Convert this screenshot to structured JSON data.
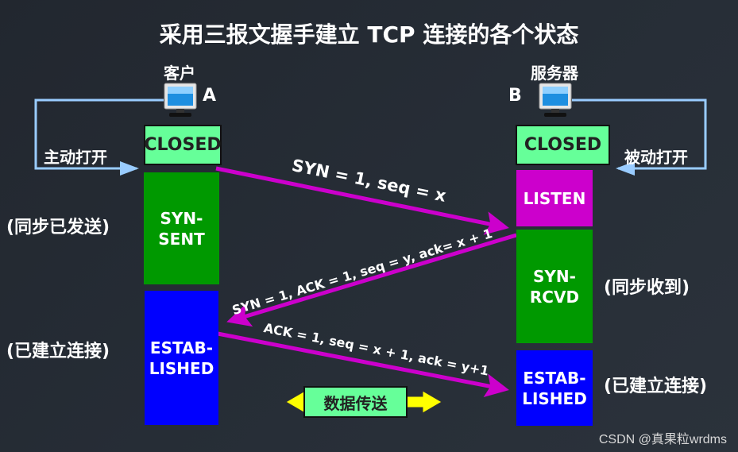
{
  "title": "采用三报文握手建立 TCP 连接的各个状态",
  "client": {
    "label": "客户",
    "letter": "A",
    "open_label": "主动打开",
    "states": [
      {
        "name": "CLOSED",
        "text": "CLOSED",
        "color": "#66ff99"
      },
      {
        "name": "SYN-SENT",
        "text": "SYN-\nSENT",
        "color": "#009900",
        "annotation": "(同步已发送)"
      },
      {
        "name": "ESTABLISHED",
        "text": "ESTAB-\nLISHED",
        "color": "#0000ff",
        "annotation": "(已建立连接)"
      }
    ]
  },
  "server": {
    "label": "服务器",
    "letter": "B",
    "open_label": "被动打开",
    "states": [
      {
        "name": "CLOSED",
        "text": "CLOSED",
        "color": "#66ff99"
      },
      {
        "name": "LISTEN",
        "text": "LISTEN",
        "color": "#cc00cc"
      },
      {
        "name": "SYN-RCVD",
        "text": "SYN-\nRCVD",
        "color": "#009900",
        "annotation": "(同步收到)"
      },
      {
        "name": "ESTABLISHED",
        "text": "ESTAB-\nLISHED",
        "color": "#0000ff",
        "annotation": "(已建立连接)"
      }
    ]
  },
  "messages": [
    {
      "from": "A",
      "to": "B",
      "text": "SYN = 1, seq = x"
    },
    {
      "from": "B",
      "to": "A",
      "text": "SYN = 1, ACK = 1, seq = y, ack= x + 1"
    },
    {
      "from": "A",
      "to": "B",
      "text": "ACK = 1, seq = x + 1, ack = y+1"
    }
  ],
  "data_transfer": {
    "label": "数据传送",
    "arrow_color": "#ffff00"
  },
  "colors": {
    "arrow": "#cc00cc",
    "open_line": "#99ccff"
  },
  "watermark": "CSDN @真果粒wrdms"
}
